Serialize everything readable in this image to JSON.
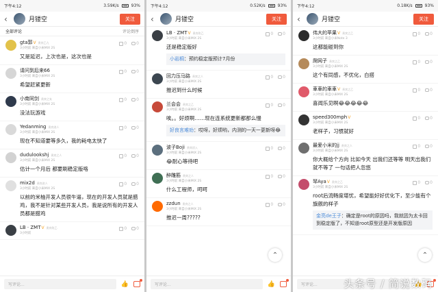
{
  "status": {
    "time": "下午4:12",
    "battery": "93%",
    "speeds": [
      "3.59K/s",
      "0.52K/s",
      "0.18K/s"
    ]
  },
  "header": {
    "back": "‹",
    "title": "月镂空",
    "follow_label": "关注"
  },
  "sortbar": {
    "left": "全部评论",
    "right": "评论倒序"
  },
  "bottom": {
    "placeholder": "写评论...",
    "fab": "⌃"
  },
  "watermark": "头条号 / 简说数码",
  "panels": [
    {
      "comments": [
        {
          "user": "gta郭",
          "verified": true,
          "lvl": "贵宾乙九",
          "sub": "3小时前  来自小米MIX 2S",
          "likes": "0",
          "replies": "0",
          "text": "又是延迟，上次也是，这次也是",
          "color": "#e2c24a"
        },
        {
          "user": "请问到后来66",
          "verified": false,
          "lvl": "",
          "sub": "3小时前  来自小米MIX 2S",
          "likes": "0",
          "replies": "0",
          "text": "希望赶紧更新",
          "color": "#d6d6d6"
        },
        {
          "user": "小南同剑",
          "verified": false,
          "lvl": "贵宾之玄",
          "sub": "3小时前  来自小米MIX 2S",
          "likes": "0",
          "replies": "0",
          "text": "没法玩游戏",
          "color": "#2f3a4c"
        },
        {
          "user": "Yedanming",
          "verified": false,
          "lvl": "贵宾进人",
          "sub": "3小时前  来自小米MIX 2S",
          "likes": "0",
          "replies": "0",
          "text": "现在不知道要等多久，我的耗电太快了",
          "color": "#d9d9d9"
        },
        {
          "user": "dudulookshj",
          "verified": false,
          "lvl": "贵宾之人",
          "sub": "3小时前  来自小米MIX 2S",
          "likes": "0",
          "replies": "0",
          "text": "估计一个月后 都要刷稳定版咯",
          "color": "#d2d2d2"
        },
        {
          "user": "mix2d",
          "verified": false,
          "lvl": "贵宾进人",
          "sub": "3小时前  来自小米MIX 2S",
          "likes": "0",
          "replies": "0",
          "text": "以前的米柚开发人员很牛逼，现在的开发人员就是腊鸡，我不是针对某些开发人员，我是说所有的开发人员都是腊鸡",
          "color": "#e0e0e0"
        },
        {
          "user": "LB · ZMT",
          "verified": true,
          "lvl": "贵宾玫乙",
          "sub": "3小时前",
          "likes": "0",
          "replies": "0",
          "text": "",
          "color": "#3a3f45"
        }
      ]
    },
    {
      "comments": [
        {
          "user": "LB · ZMT",
          "verified": true,
          "lvl": "贵宾玫乙",
          "sub": "3小时前  来自小米MIX 2S",
          "likes": "0",
          "replies": "0",
          "text": "还是稳定版好",
          "color": "#3a3f45",
          "quote_user": "小岩桐",
          "quote_text": "：预约稳定版预计7月份"
        },
        {
          "user": "回力压马路",
          "verified": false,
          "lvl": "贵宾之人",
          "sub": "3小时前  来自小米MIX 2S",
          "likes": "0",
          "replies": "0",
          "text": "推迟到什么时候",
          "color": "#3c4650"
        },
        {
          "user": "兰会会",
          "verified": false,
          "lvl": "贵宾之乙",
          "sub": "3小时前  来自小米MIX 2S",
          "likes": "0",
          "replies": "0",
          "text": "唉。。好烦啊……现在连系统更新都那么慢",
          "color": "#c74a3a",
          "quote_user": "好良言难劝",
          "quote_text": "：哎呀，好烦哟，内测的一天一更新呀😂"
        },
        {
          "user": "波子Boji",
          "verified": false,
          "lvl": "贵宾初入",
          "sub": "3小时前  来自小米MIX 2S",
          "likes": "0",
          "replies": "0",
          "text": "😂耐心等待吧",
          "color": "#5c6f7e"
        },
        {
          "user": "醉雕筋",
          "verified": false,
          "lvl": "贵宾之人",
          "sub": "3小时前  来自小米MIX 2S",
          "likes": "0",
          "replies": "0",
          "text": "什么工程师，呵呵",
          "color": "#3f6f54"
        },
        {
          "user": "zzdun",
          "verified": false,
          "lvl": "贵宾之人",
          "sub": "3小时前  来自小米MIX 2S",
          "likes": "0",
          "replies": "0",
          "text": "推迟一周?????",
          "color": "#ff6a00"
        }
      ]
    },
    {
      "comments": [
        {
          "user": "伟大的苹果",
          "verified": true,
          "lvl": "贵宾之乙",
          "sub": "3小时前  来自小米Note 3",
          "likes": "0",
          "replies": "0",
          "text": "这都能碰到你",
          "color": "#2b2b2b"
        },
        {
          "user": "爬网子",
          "verified": false,
          "lvl": "贵宾之乙",
          "sub": "3小时前  来自小米MIX 2S",
          "likes": "0",
          "replies": "0",
          "text": "这个有同感，不优化，白搭",
          "color": "#b58a5a"
        },
        {
          "user": "車車的車車",
          "verified": true,
          "lvl": "贵宾之乙",
          "sub": "3小时前  来自小米MIX 2S",
          "likes": "0",
          "replies": "0",
          "text": "喜闻乐见啊😂😂😂😂😂",
          "color": "#e05a6a"
        },
        {
          "user": "speed300mph",
          "verified": true,
          "lvl": "",
          "sub": "3小时前  来自小米MIX 2S",
          "likes": "0",
          "replies": "0",
          "text": "老样子，习惯就好",
          "color": "#333333"
        },
        {
          "user": "最爱小米的jj",
          "verified": false,
          "lvl": "贵宾之人",
          "sub": "3小时前  来自小米MIX 2S",
          "likes": "0",
          "replies": "0",
          "text": "你大概给个方向 比如今天 出我们还等等 明天出我们就不等了 一句话把人忽悠",
          "color": "#6f6f6f"
        },
        {
          "user": "琴Aya",
          "verified": true,
          "lvl": "贵宾之乙",
          "sub": "3小时前  来自小米MIX 2S",
          "likes": "0",
          "replies": "0",
          "text": "root后流畅度堪忧，希望能好好优化下，至少能有个旗舰的样子",
          "color": "#c44d6c",
          "quote_user": "金亮de王子",
          "quote_text": "：确定是root的原因吗，我就因为太卡回到稳定版了，不知道root原型还是开发版原因"
        }
      ]
    }
  ]
}
